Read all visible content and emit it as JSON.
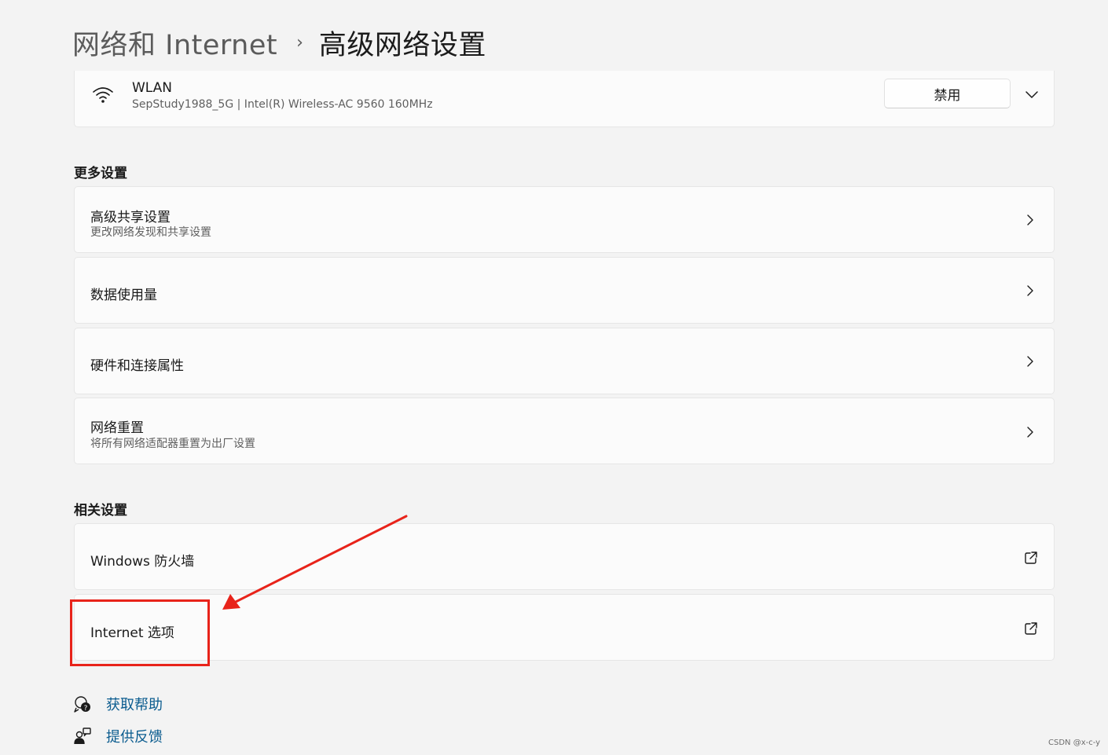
{
  "breadcrumb": {
    "parent": "网络和 Internet",
    "separator": "›",
    "current": "高级网络设置"
  },
  "adapter": {
    "name": "WLAN",
    "detail": "SepStudy1988_5G | Intel(R) Wireless-AC 9560 160MHz",
    "disable_label": "禁用",
    "icon": "wifi-icon"
  },
  "more_settings": {
    "heading": "更多设置",
    "items": [
      {
        "title": "高级共享设置",
        "subtitle": "更改网络发现和共享设置"
      },
      {
        "title": "数据使用量",
        "subtitle": ""
      },
      {
        "title": "硬件和连接属性",
        "subtitle": ""
      },
      {
        "title": "网络重置",
        "subtitle": "将所有网络适配器重置为出厂设置"
      }
    ]
  },
  "related_settings": {
    "heading": "相关设置",
    "items": [
      {
        "title": "Windows 防火墙",
        "icon": "external-link-icon"
      },
      {
        "title": "Internet 选项",
        "icon": "external-link-icon"
      }
    ]
  },
  "help": {
    "get_help": "获取帮助",
    "feedback": "提供反馈"
  },
  "watermark": "CSDN @x-c-y",
  "colors": {
    "background": "#f3f3f3",
    "card": "#fbfbfb",
    "link": "#0b5c8f",
    "annotation": "#e8231a"
  }
}
